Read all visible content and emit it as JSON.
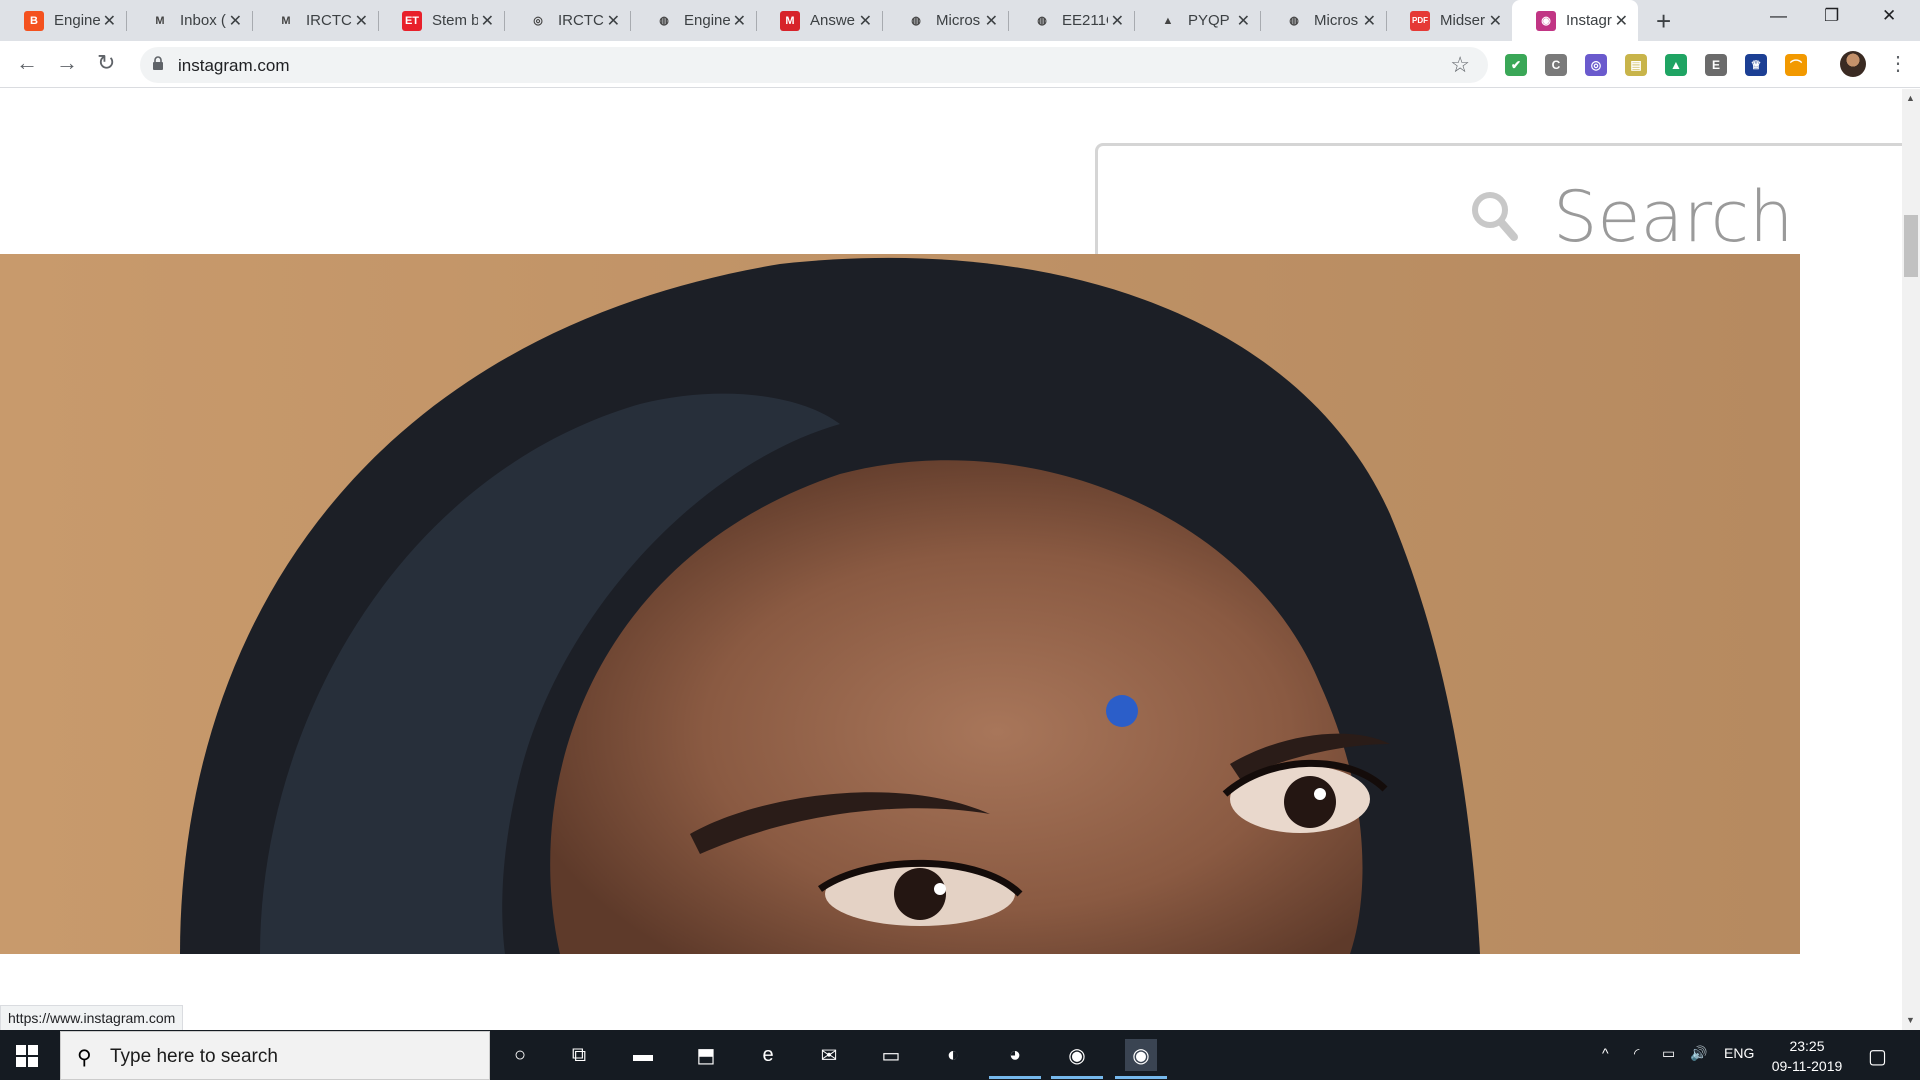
{
  "browser": {
    "tabs": [
      {
        "title": "Engine",
        "favicon": "blogger-icon",
        "color": "#f4511e",
        "glyph": "B"
      },
      {
        "title": "Inbox (",
        "favicon": "gmail-icon",
        "color": "#ffffff",
        "glyph": "M"
      },
      {
        "title": "IRCTC",
        "favicon": "gmail-icon",
        "color": "#ffffff",
        "glyph": "M"
      },
      {
        "title": "Stem b",
        "favicon": "et-icon",
        "color": "#e8202a",
        "glyph": "ET"
      },
      {
        "title": "IRCTC",
        "favicon": "irctc-icon",
        "color": "#ffffff",
        "glyph": "◎"
      },
      {
        "title": "Engine",
        "favicon": "globe-icon",
        "color": "#ffffff",
        "glyph": "◍"
      },
      {
        "title": "Answe",
        "favicon": "mcq-icon",
        "color": "#d7232a",
        "glyph": "M"
      },
      {
        "title": "Micros",
        "favicon": "globe-icon",
        "color": "#ffffff",
        "glyph": "◍"
      },
      {
        "title": "EE211C",
        "favicon": "globe-icon",
        "color": "#ffffff",
        "glyph": "◍"
      },
      {
        "title": "PYQP -",
        "favicon": "drive-icon",
        "color": "#ffffff",
        "glyph": "▲"
      },
      {
        "title": "Micros",
        "favicon": "globe-icon",
        "color": "#ffffff",
        "glyph": "◍"
      },
      {
        "title": "Midser",
        "favicon": "pdf-icon",
        "color": "#e53935",
        "glyph": "PDF"
      },
      {
        "title": "Instagr",
        "favicon": "instagram-icon",
        "color": "#c13584",
        "glyph": "◉",
        "active": true
      }
    ],
    "new_tab": "+",
    "minimize": "—",
    "restore": "❐",
    "close": "✕",
    "back": "←",
    "forward": "→",
    "reload": "↻",
    "url": "instagram.com",
    "bookmark": "☆",
    "extensions": [
      {
        "name": "adblock-shield-icon",
        "color": "#3aa757",
        "glyph": "✔"
      },
      {
        "name": "extension-c-icon",
        "color": "#7a7a7a",
        "glyph": "C"
      },
      {
        "name": "extension-circle-icon",
        "color": "#6a5acd",
        "glyph": "◎"
      },
      {
        "name": "extension-notes-icon",
        "color": "#c8b44a",
        "glyph": "▤"
      },
      {
        "name": "drive-extension-icon",
        "color": "#1fa463",
        "glyph": "▲"
      },
      {
        "name": "extension-e-icon",
        "color": "#6b6b6b",
        "glyph": "E"
      },
      {
        "name": "extension-crest-icon",
        "color": "#1c3f94",
        "glyph": "♕"
      },
      {
        "name": "extension-wave-icon",
        "color": "#f29900",
        "glyph": "⌒"
      }
    ],
    "menu": "⋮",
    "status_url": "https://www.instagram.com"
  },
  "page": {
    "search_placeholder": "Search"
  },
  "taskbar": {
    "search_placeholder": "Type here to search",
    "search_icon": "⚲",
    "apps": [
      {
        "name": "cortana-icon",
        "glyph": "○"
      },
      {
        "name": "task-view-icon",
        "glyph": "⧉"
      },
      {
        "name": "file-explorer-icon",
        "glyph": "▬"
      },
      {
        "name": "store-icon",
        "glyph": "⬒"
      },
      {
        "name": "edge-icon",
        "glyph": "e"
      },
      {
        "name": "mail-icon",
        "glyph": "✉"
      },
      {
        "name": "terminal-icon",
        "glyph": "▭"
      },
      {
        "name": "snipping-icon",
        "glyph": "◐"
      },
      {
        "name": "firefox-icon",
        "glyph": "◕"
      },
      {
        "name": "chrome-icon",
        "glyph": "◉"
      },
      {
        "name": "chrome-profile-icon",
        "glyph": "◉"
      }
    ],
    "tray": {
      "chevron": "^",
      "wifi": "◜",
      "battery": "▭",
      "volume": "🔊",
      "language": "ENG"
    },
    "time": "23:25",
    "date": "09-11-2019",
    "notifications": "▢"
  }
}
